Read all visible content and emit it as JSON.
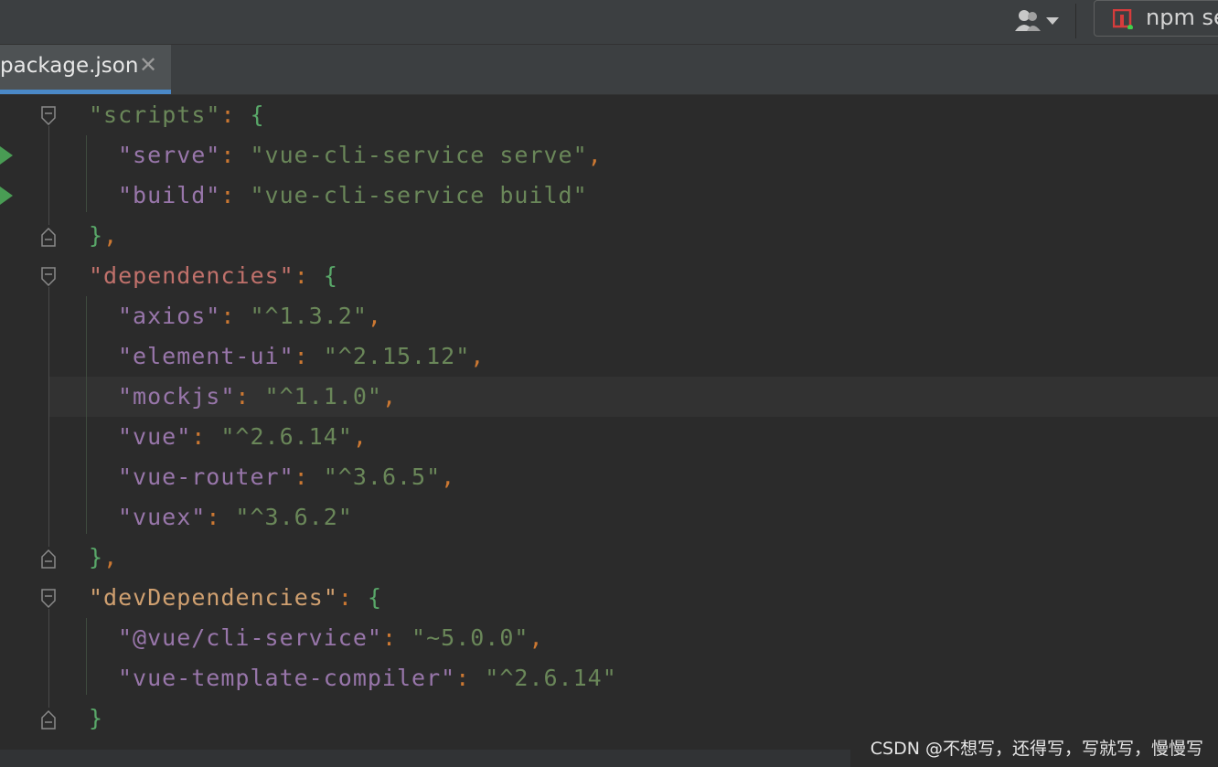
{
  "toolbar": {
    "user_icon": "user-icon",
    "run_config_label": "npm se"
  },
  "tab": {
    "label": "package.json",
    "close": "✕"
  },
  "code_lines": [
    {
      "indent": 1,
      "key": "\"scripts\"",
      "key_style": "green",
      "sep": ": ",
      "value": "",
      "open": "{",
      "trail": "",
      "fold": "open",
      "run": false
    },
    {
      "indent": 2,
      "key": "\"serve\"",
      "key_style": "purple",
      "sep": ": ",
      "value": "\"vue-cli-service serve\"",
      "open": "",
      "trail": ",",
      "fold": "",
      "run": true
    },
    {
      "indent": 2,
      "key": "\"build\"",
      "key_style": "purple",
      "sep": ": ",
      "value": "\"vue-cli-service build\"",
      "open": "",
      "trail": "",
      "fold": "",
      "run": true
    },
    {
      "indent": 1,
      "key": "",
      "key_style": "",
      "sep": "",
      "value": "",
      "open": "}",
      "trail": ",",
      "fold": "close",
      "run": false
    },
    {
      "indent": 1,
      "key": "\"dependencies\"",
      "key_style": "red",
      "sep": ": ",
      "value": "",
      "open": "{",
      "trail": "",
      "fold": "open",
      "run": false
    },
    {
      "indent": 2,
      "key": "\"axios\"",
      "key_style": "purple",
      "sep": ": ",
      "value": "\"^1.3.2\"",
      "open": "",
      "trail": ",",
      "fold": "",
      "run": false
    },
    {
      "indent": 2,
      "key": "\"element-ui\"",
      "key_style": "purple",
      "sep": ": ",
      "value": "\"^2.15.12\"",
      "open": "",
      "trail": ",",
      "fold": "",
      "run": false
    },
    {
      "indent": 2,
      "key": "\"mockjs\"",
      "key_style": "purple",
      "sep": ": ",
      "value": "\"^1.1.0\"",
      "open": "",
      "trail": ",",
      "fold": "",
      "run": false,
      "caret": true
    },
    {
      "indent": 2,
      "key": "\"vue\"",
      "key_style": "purple",
      "sep": ": ",
      "value": "\"^2.6.14\"",
      "open": "",
      "trail": ",",
      "fold": "",
      "run": false
    },
    {
      "indent": 2,
      "key": "\"vue-router\"",
      "key_style": "purple",
      "sep": ": ",
      "value": "\"^3.6.5\"",
      "open": "",
      "trail": ",",
      "fold": "",
      "run": false
    },
    {
      "indent": 2,
      "key": "\"vuex\"",
      "key_style": "purple",
      "sep": ": ",
      "value": "\"^3.6.2\"",
      "open": "",
      "trail": "",
      "fold": "",
      "run": false
    },
    {
      "indent": 1,
      "key": "",
      "key_style": "",
      "sep": "",
      "value": "",
      "open": "}",
      "trail": ",",
      "fold": "close",
      "run": false
    },
    {
      "indent": 1,
      "key": "\"devDependencies\"",
      "key_style": "orange",
      "sep": ": ",
      "value": "",
      "open": "{",
      "trail": "",
      "fold": "open",
      "run": false
    },
    {
      "indent": 2,
      "key": "\"@vue/cli-service\"",
      "key_style": "purple",
      "sep": ": ",
      "value": "\"~5.0.0\"",
      "open": "",
      "trail": ",",
      "fold": "",
      "run": false
    },
    {
      "indent": 2,
      "key": "\"vue-template-compiler\"",
      "key_style": "purple",
      "sep": ": ",
      "value": "\"^2.6.14\"",
      "open": "",
      "trail": "",
      "fold": "",
      "run": false
    },
    {
      "indent": 1,
      "key": "",
      "key_style": "",
      "sep": "",
      "value": "",
      "open": "}",
      "trail": "",
      "fold": "close",
      "run": false
    }
  ],
  "watermark": "CSDN @不想写，还得写，写就写，慢慢写",
  "colors": {
    "editor_bg": "#2b2b2b",
    "key_purple": "#9876aa",
    "string_green": "#6a8759",
    "punctuation": "#cc7832",
    "brace": "#59a869",
    "run_gutter_green": "#499c54",
    "tab_accent": "#4a88c7"
  }
}
